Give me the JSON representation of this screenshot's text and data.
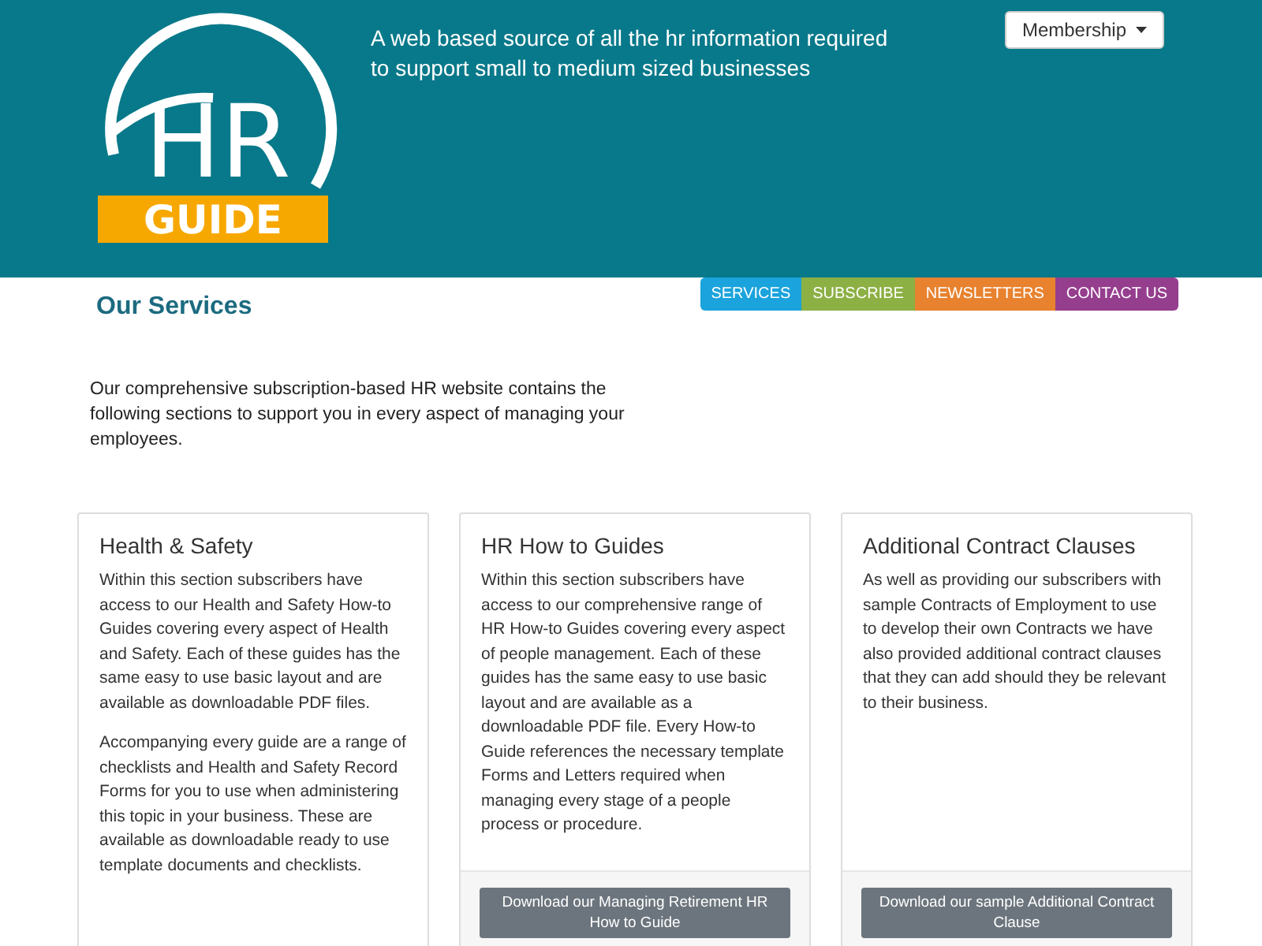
{
  "header": {
    "logo": {
      "letters": "HR",
      "banner": "GUIDE"
    },
    "tagline": "A web based source of all the hr information required to support small to medium sized businesses",
    "membership_button": "Membership"
  },
  "nav": [
    {
      "label": "SERVICES",
      "color": "#1aa3dc"
    },
    {
      "label": "SUBSCRIBE",
      "color": "#8cb044"
    },
    {
      "label": "NEWSLETTERS",
      "color": "#e8822f"
    },
    {
      "label": "CONTACT US",
      "color": "#953e8e"
    }
  ],
  "page_title": "Our Services",
  "intro": "Our comprehensive subscription-based HR website contains the following sections to support you in every aspect of managing your employees.",
  "cards": [
    {
      "title": "Health & Safety",
      "paragraphs": [
        "Within this section subscribers have access to our Health and Safety How-to Guides covering every aspect of Health and Safety. Each of these guides has the same easy to use basic layout and are available as downloadable PDF files.",
        "Accompanying every guide are a range of checklists and Health and Safety Record Forms for you to use when administering this topic in your business. These are available as downloadable ready to use template documents and checklists."
      ]
    },
    {
      "title": "HR How to Guides",
      "paragraphs": [
        "Within this section subscribers have access to our comprehensive range of HR How-to Guides covering every aspect of people management. Each of these guides has the same easy to use basic layout and are available as a  downloadable PDF file. Every How-to Guide references the necessary template Forms and Letters required when managing every stage of a people process or procedure."
      ],
      "button": "Download our Managing Retirement HR How to Guide"
    },
    {
      "title": "Additional Contract Clauses",
      "paragraphs": [
        "As well as providing our subscribers with sample Contracts of Employment to use to develop their own Contracts we have also provided additional contract clauses that they can add should they be relevant to their business."
      ],
      "button": "Download our sample Additional Contract Clause"
    }
  ]
}
